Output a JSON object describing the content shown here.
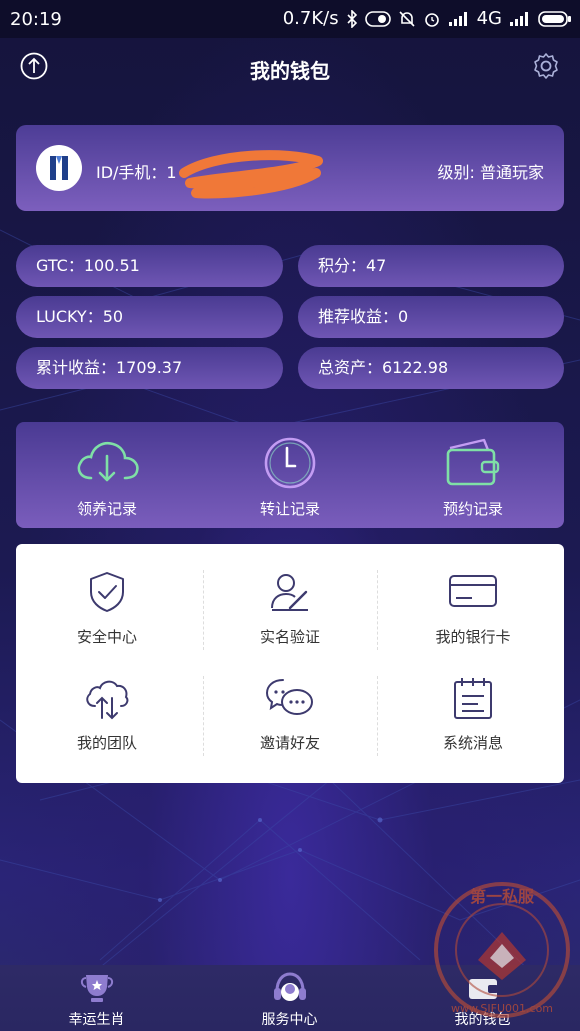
{
  "status_bar": {
    "time": "20:19",
    "speed": "0.7K/s",
    "network": "4G"
  },
  "header": {
    "title": "我的钱包"
  },
  "account": {
    "id_label": "ID/手机：1",
    "level": "级别: 普通玩家"
  },
  "stats": {
    "gtc": "GTC：100.51",
    "points": "积分：47",
    "lucky": "LUCKY：50",
    "referral": "推荐收益：0",
    "total_income": "累计收益：1709.37",
    "total_assets": "总资产：6122.98"
  },
  "records": [
    {
      "label": "领养记录",
      "icon": "cloud-download-icon"
    },
    {
      "label": "转让记录",
      "icon": "clock-icon"
    },
    {
      "label": "预约记录",
      "icon": "wallet-icon"
    }
  ],
  "menu": [
    {
      "label": "安全中心",
      "icon": "shield-check-icon"
    },
    {
      "label": "实名验证",
      "icon": "user-edit-icon"
    },
    {
      "label": "我的银行卡",
      "icon": "bank-card-icon"
    },
    {
      "label": "我的团队",
      "icon": "cloud-sync-icon"
    },
    {
      "label": "邀请好友",
      "icon": "chat-bubbles-icon"
    },
    {
      "label": "系统消息",
      "icon": "notepad-icon"
    }
  ],
  "tabs": [
    {
      "label": "幸运生肖",
      "icon": "trophy-icon"
    },
    {
      "label": "服务中心",
      "icon": "headset-icon"
    },
    {
      "label": "我的钱包",
      "icon": "wallet-tab-icon"
    }
  ],
  "watermark": {
    "text": "第一私服",
    "url_text": "www.SIFU001.com"
  },
  "colors": {
    "background": "#1a1748",
    "card_top": "#4d3d96",
    "card_bottom": "#7c5fbd",
    "icon_green": "#7fe0a6",
    "icon_purple": "#c39cf3",
    "menu_icon": "#3d3a6e"
  }
}
